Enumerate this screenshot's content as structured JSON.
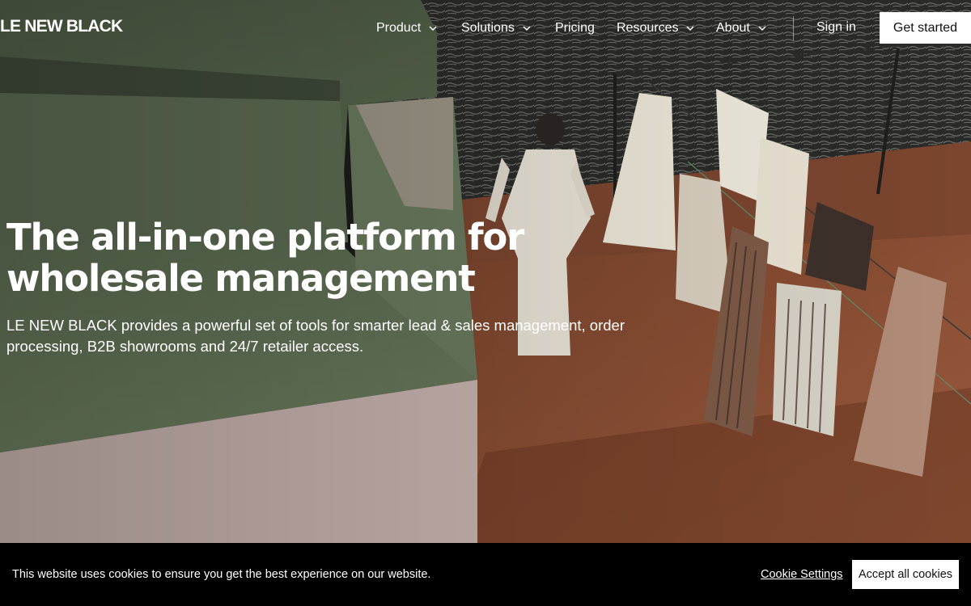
{
  "brand": {
    "logo_text": "LE NEW BLACK"
  },
  "nav": {
    "items": [
      {
        "label": "Product",
        "has_dropdown": true
      },
      {
        "label": "Solutions",
        "has_dropdown": true
      },
      {
        "label": "Pricing",
        "has_dropdown": false
      },
      {
        "label": "Resources",
        "has_dropdown": true
      },
      {
        "label": "About",
        "has_dropdown": true
      }
    ],
    "sign_in": "Sign in",
    "cta": "Get started",
    "dropdown_icon": "chevron-down-icon"
  },
  "hero": {
    "title_line1": "The all-in-one platform for",
    "title_line2": "wholesale management",
    "subtitle_line1": "LE NEW BLACK provides a powerful set of tools for smarter lead & sales management, order",
    "subtitle_line2": "processing, B2B showrooms and 24/7 retailer access."
  },
  "cookie_banner": {
    "message": "This website uses cookies to ensure you get the best experience on our website.",
    "settings_label": "Cookie Settings",
    "accept_label": "Accept all cookies"
  },
  "colors": {
    "wall_green": "#5e6e55",
    "terracotta": "#8a4d33",
    "sea_dark": "#262624",
    "cookie_bg": "#000000",
    "button_bg": "#ffffff"
  }
}
